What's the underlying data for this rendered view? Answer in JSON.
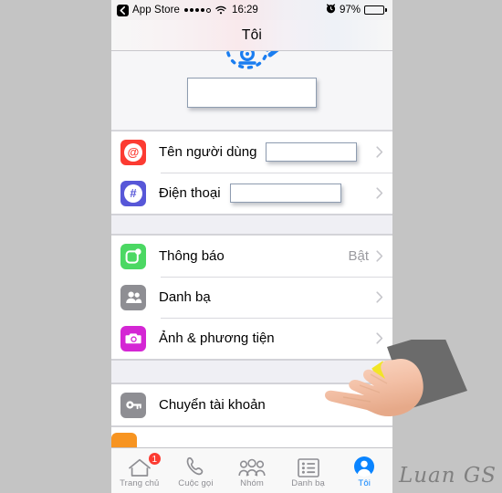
{
  "background_color": "#c4c4c4",
  "status_bar": {
    "back_label": "App Store",
    "back_icon": "chevron-left-icon",
    "signal_icon": "signal-dots-icon",
    "signal_dots_filled": 4,
    "signal_dots_total": 5,
    "wifi_icon": "wifi-icon",
    "time": "16:29",
    "alarm_icon": "alarm-clock-icon",
    "battery_percent": "97%",
    "battery_icon": "battery-icon",
    "battery_level": 97
  },
  "nav_bar": {
    "title": "Tôi"
  },
  "profile": {
    "avatar_icon": "avatar-placeholder-icon",
    "edit_icon": "pencil-edit-icon",
    "avatar_color": "#1a7df0",
    "name_redacted": true
  },
  "sections": [
    {
      "id": "account",
      "rows": [
        {
          "icon": "at-sign-icon",
          "icon_color": "#fc3b32",
          "icon_glyph": "@",
          "label": "Tên người dùng",
          "value": "",
          "redacted": true,
          "redact_width": 100,
          "chevron": true
        },
        {
          "icon": "hash-icon",
          "icon_color": "#5757d8",
          "icon_glyph": "#",
          "label": "Điện thoại",
          "value": "",
          "redacted": true,
          "redact_width": 122,
          "chevron": true
        }
      ]
    },
    {
      "id": "preferences",
      "rows": [
        {
          "icon": "notification-icon",
          "icon_color": "#4bd863",
          "label": "Thông báo",
          "value": "Bật",
          "redacted": false,
          "chevron": true
        },
        {
          "icon": "contacts-icon",
          "icon_color": "#8e8e93",
          "label": "Danh bạ",
          "value": "",
          "redacted": false,
          "chevron": true
        },
        {
          "icon": "camera-icon",
          "icon_color": "#d426d4",
          "label": "Ảnh & phương tiện",
          "value": "",
          "redacted": false,
          "chevron": true
        }
      ]
    },
    {
      "id": "account-actions",
      "rows": [
        {
          "icon": "key-icon",
          "icon_color": "#8e8e93",
          "label": "Chuyển tài khoản",
          "value": "",
          "redacted": false,
          "chevron": false
        }
      ]
    }
  ],
  "partial_row": {
    "icon": "orange-app-icon",
    "icon_color": "#f79421"
  },
  "tab_bar": {
    "items": [
      {
        "label": "Trang chủ",
        "icon": "home-icon",
        "badge": "1",
        "active": false
      },
      {
        "label": "Cuộc gọi",
        "icon": "phone-icon",
        "badge": "",
        "active": false
      },
      {
        "label": "Nhóm",
        "icon": "group-icon",
        "badge": "",
        "active": false
      },
      {
        "label": "Danh bạ",
        "icon": "list-icon",
        "badge": "",
        "active": false
      },
      {
        "label": "Tôi",
        "icon": "person-icon",
        "badge": "",
        "active": true
      }
    ],
    "active_color": "#0a84ff",
    "inactive_color": "#8e8e93",
    "badge_color": "#fc3b32"
  },
  "overlay": {
    "hand_icon": "pointing-hand-icon",
    "sleeve_color": "#6b6b6b",
    "cuff_color": "#f2e527"
  },
  "watermark": {
    "text": "Luan GS"
  }
}
